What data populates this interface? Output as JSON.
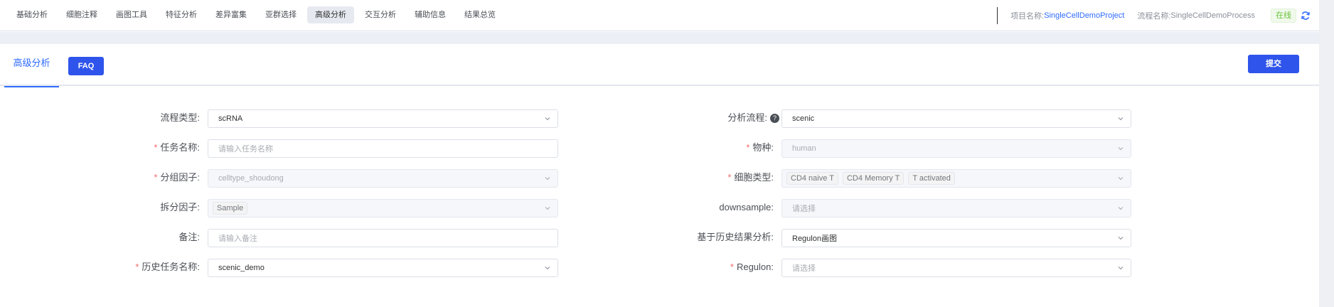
{
  "nav": {
    "items": [
      {
        "label": "基础分析"
      },
      {
        "label": "细胞注释"
      },
      {
        "label": "画图工具"
      },
      {
        "label": "特征分析"
      },
      {
        "label": "差异富集"
      },
      {
        "label": "亚群选择"
      },
      {
        "label": "高级分析",
        "active": true
      },
      {
        "label": "交互分析"
      },
      {
        "label": "辅助信息"
      },
      {
        "label": "结果总览"
      }
    ]
  },
  "header": {
    "project_label": "项目名称:",
    "project_value": "SingleCellDemoProject",
    "flow_label": "流程名称:",
    "flow_value": "SingleCellDemoProcess",
    "status": "在线",
    "refresh_icon": "refresh-icon"
  },
  "tabs": {
    "active_label": "高级分析",
    "faq_label": "FAQ",
    "submit_label": "提交"
  },
  "form": {
    "flow_type": {
      "label": "流程类型:",
      "value": "scRNA"
    },
    "task_name": {
      "label": "任务名称:",
      "placeholder": "请输入任务名称",
      "required": true
    },
    "group_factor": {
      "label": "分组因子:",
      "value": "celltype_shoudong",
      "required": true
    },
    "split_factor": {
      "label": "拆分因子:",
      "tag": "Sample"
    },
    "note": {
      "label": "备注:",
      "placeholder": "请输入备注"
    },
    "history_task": {
      "label": "历史任务名称:",
      "value": "scenic_demo",
      "required": true
    },
    "analysis_flow": {
      "label": "分析流程:",
      "value": "scenic"
    },
    "species": {
      "label": "物种:",
      "value": "human",
      "required": true
    },
    "cell_type": {
      "label": "细胞类型:",
      "tags": [
        "CD4 naive T",
        "CD4 Memory T",
        "T activated"
      ],
      "required": true
    },
    "downsample": {
      "label": "downsample:",
      "placeholder": "请选择"
    },
    "history_result": {
      "label": "基于历史结果分析:",
      "value": "Regulon画图"
    },
    "regulon": {
      "label": "Regulon:",
      "placeholder": "请选择",
      "required": true
    }
  },
  "colors": {
    "accent": "#2f54eb",
    "link": "#2f6bff",
    "required": "#f56c6c",
    "online": "#67c23a"
  }
}
